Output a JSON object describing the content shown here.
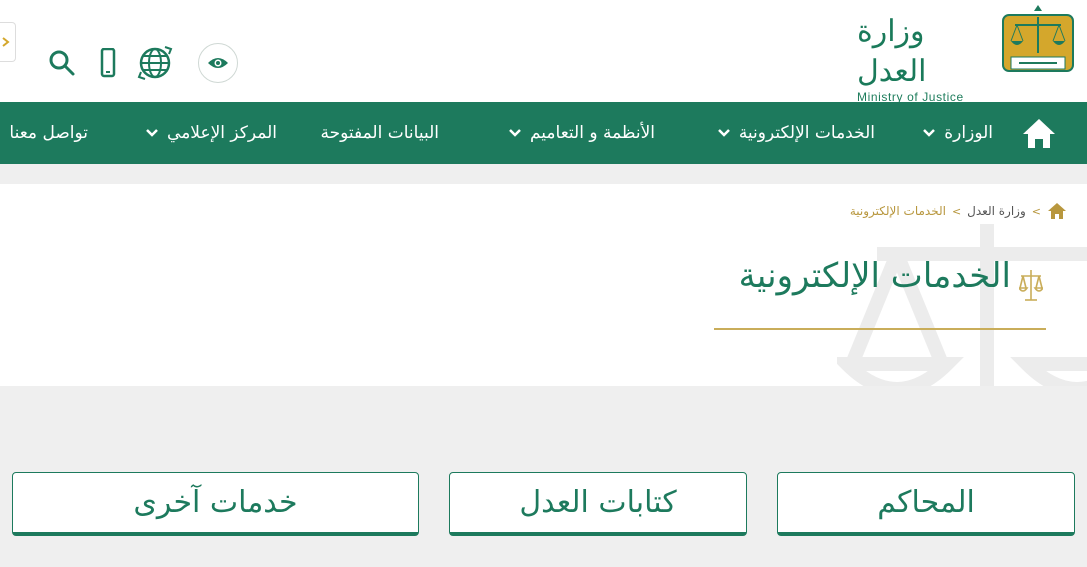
{
  "logo": {
    "name_ar": "وزارة العدل",
    "name_en": "Ministry of Justice",
    "emblem_icon": "scales-emblem-icon"
  },
  "toolbar": {
    "icons": [
      "eye-icon",
      "globe-icon",
      "mobile-icon",
      "search-icon",
      "arrow-right-icon"
    ]
  },
  "nav": {
    "home_icon": "home-icon",
    "items": [
      {
        "label": "الوزارة",
        "has_dropdown": true
      },
      {
        "label": "الخدمات الإلكترونية",
        "has_dropdown": true
      },
      {
        "label": "الأنظمة و التعاميم",
        "has_dropdown": true
      },
      {
        "label": "البيانات المفتوحة",
        "has_dropdown": false
      },
      {
        "label": "المركز الإعلامي",
        "has_dropdown": true
      },
      {
        "label": "تواصل معنا",
        "has_dropdown": false
      }
    ]
  },
  "breadcrumb": {
    "home_icon": "home-icon",
    "items": [
      "وزارة العدل",
      "الخدمات الإلكترونية"
    ],
    "separator": ">"
  },
  "page": {
    "title": "الخدمات الإلكترونية",
    "title_icon": "scales-icon"
  },
  "cards": [
    {
      "label": "المحاكم"
    },
    {
      "label": "كتابات العدل"
    },
    {
      "label": "خدمات آخرى"
    }
  ],
  "colors": {
    "primary": "#1d7a5d",
    "accent": "#c9ad5a",
    "background": "#efefef"
  }
}
